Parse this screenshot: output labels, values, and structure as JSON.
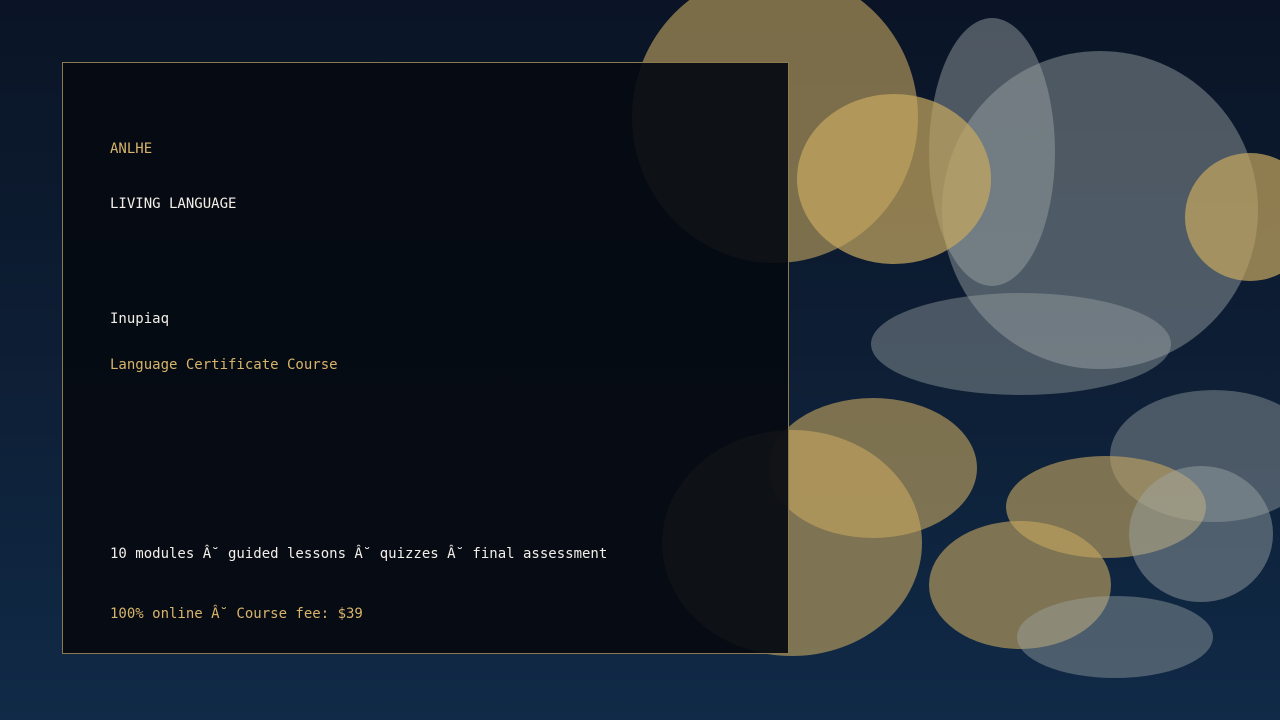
{
  "brand": "ANLHE",
  "kicker": "LIVING LANGUAGE",
  "course": {
    "title": "Inupiaq",
    "subtitle": "Language Certificate Course"
  },
  "details": "10 modules Â˘ guided lessons Â˘ quizzes Â˘ final assessment",
  "pricing": "100% online Â˘ Course fee: $39",
  "colors": {
    "accent_gold": "#d8b46a",
    "text_white": "#f2efe8",
    "background_navy": "#0d1d33",
    "card_border": "#8a7a4e"
  }
}
